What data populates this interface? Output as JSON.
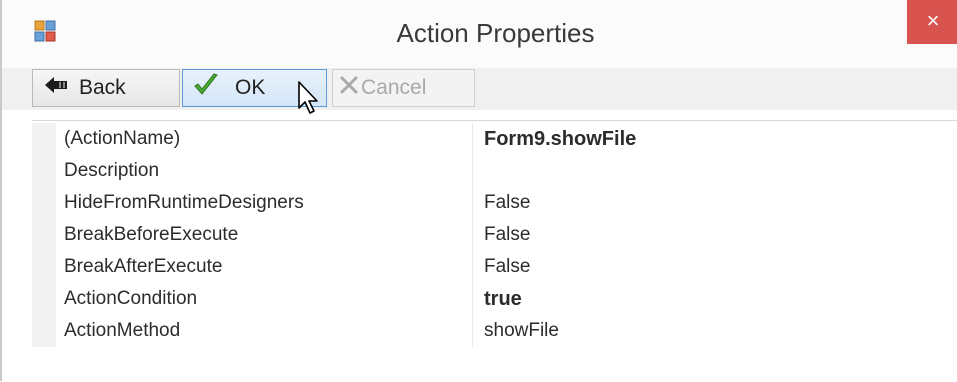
{
  "window": {
    "title": "Action Properties",
    "close_label": "×"
  },
  "toolbar": {
    "back_label": "Back",
    "ok_label": "OK",
    "cancel_label": "Cancel"
  },
  "properties": [
    {
      "name": "(ActionName)",
      "value": "Form9.showFile",
      "bold": true
    },
    {
      "name": "Description",
      "value": "",
      "bold": false
    },
    {
      "name": "HideFromRuntimeDesigners",
      "value": "False",
      "bold": false
    },
    {
      "name": "BreakBeforeExecute",
      "value": "False",
      "bold": false
    },
    {
      "name": "BreakAfterExecute",
      "value": "False",
      "bold": false
    },
    {
      "name": "ActionCondition",
      "value": "true",
      "bold": true
    },
    {
      "name": "ActionMethod",
      "value": "showFile",
      "bold": false
    }
  ],
  "icons": {
    "app": "form-app-icon",
    "back": "back-arrow-icon",
    "ok": "checkmark-icon",
    "cancel": "x-cancel-icon",
    "close": "close-icon"
  },
  "colors": {
    "close_button": "#d9534f",
    "ok_check": "#4aa834",
    "ok_border": "#5b9bd5"
  }
}
